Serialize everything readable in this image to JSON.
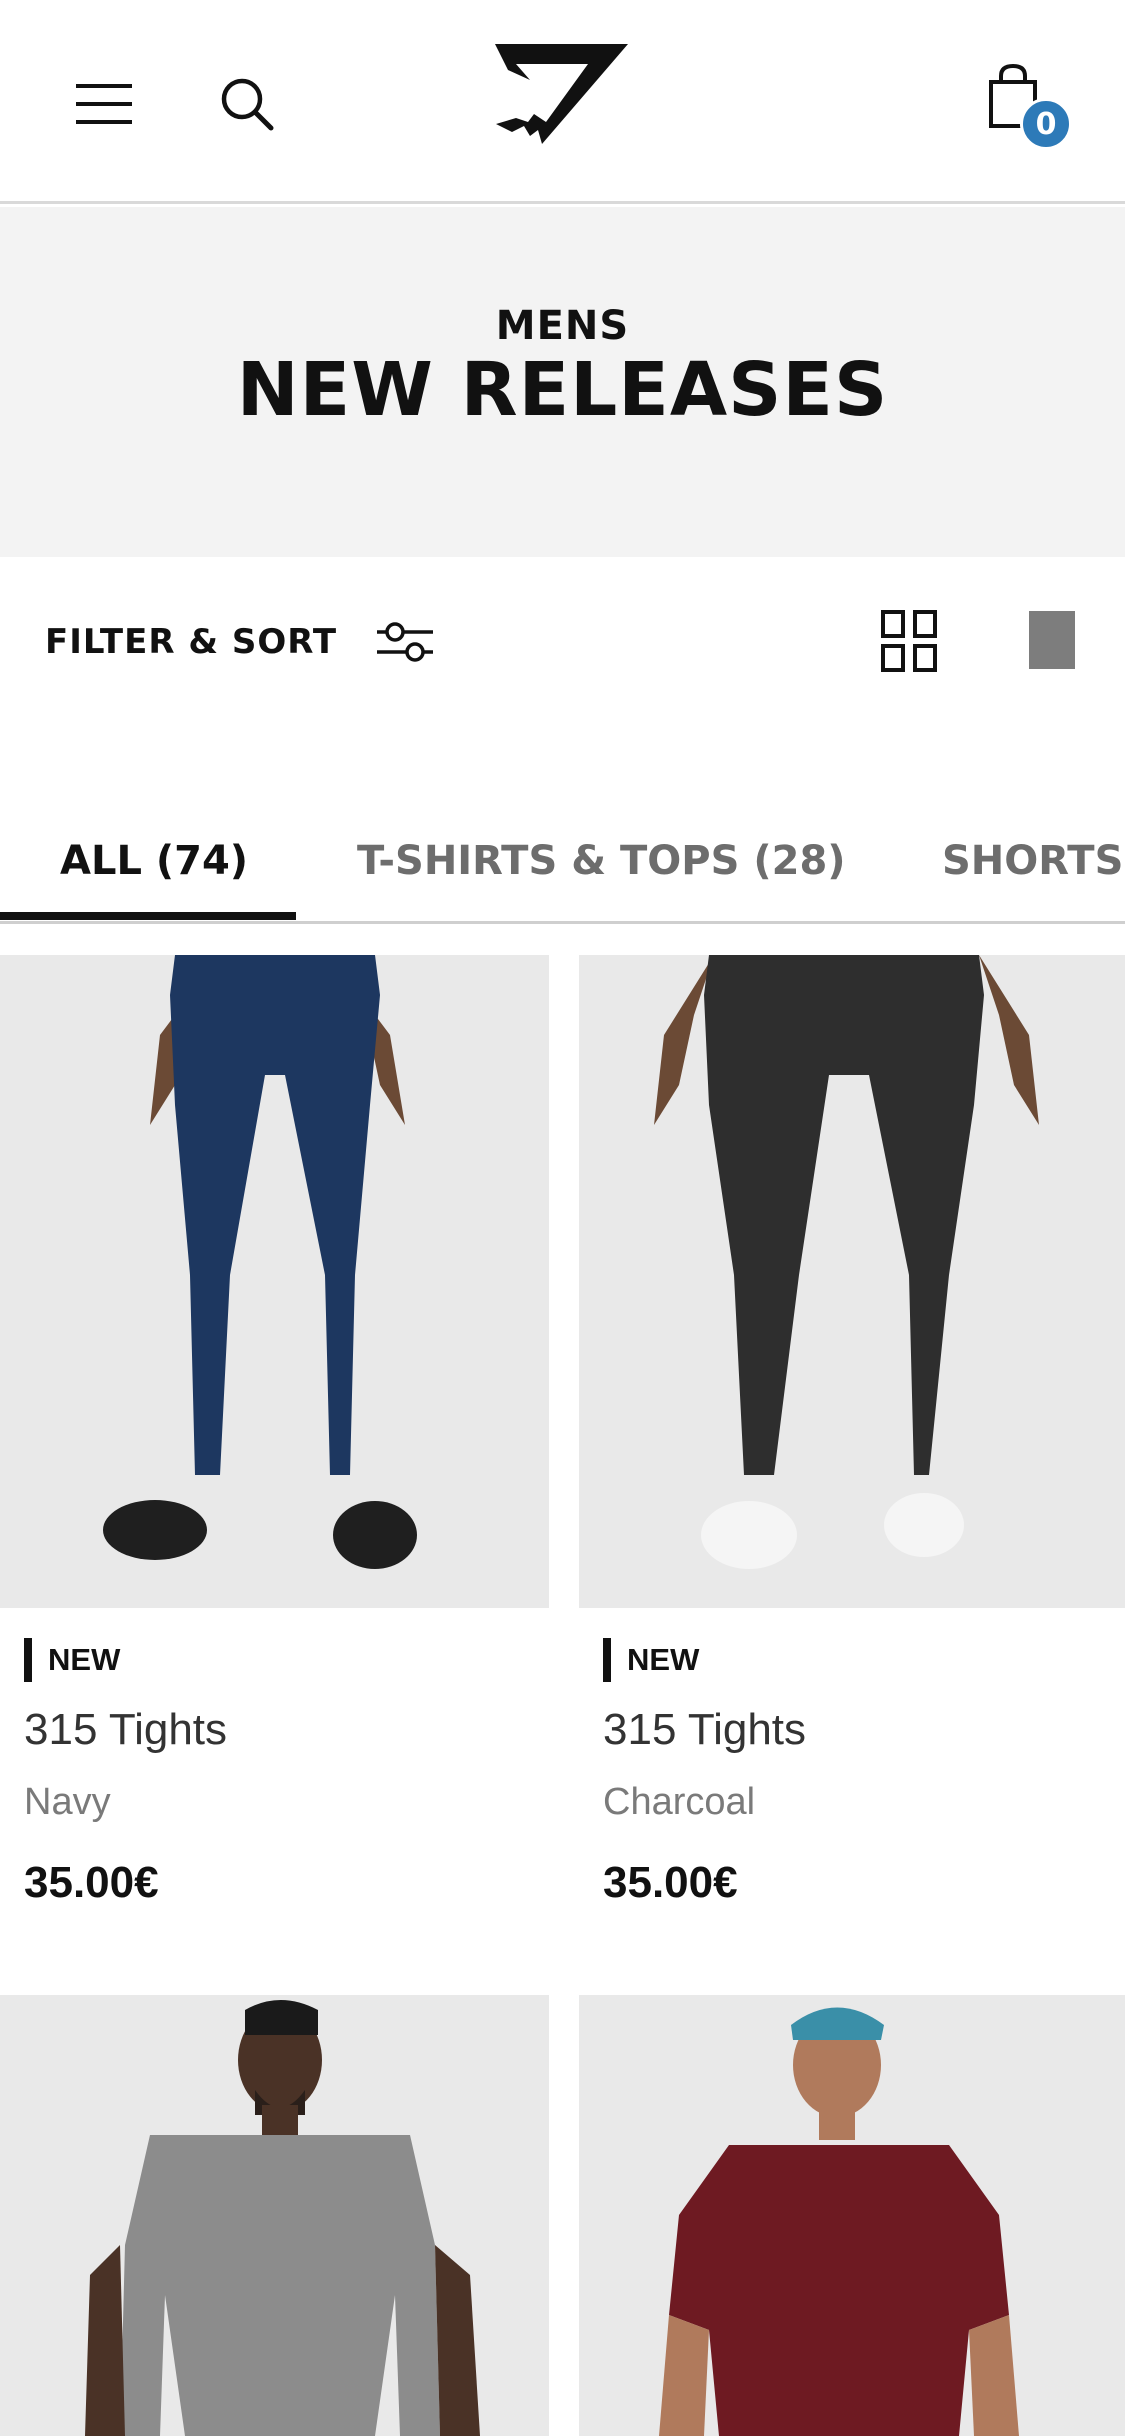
{
  "header": {
    "menu_icon": "hamburger-menu-icon",
    "search_icon": "search-icon",
    "logo_icon": "brand-logo",
    "bag_icon": "shopping-bag-icon",
    "bag_count": "0",
    "accent_color": "#2d7ab8"
  },
  "hero": {
    "subtitle": "MENS",
    "title": "NEW RELEASES"
  },
  "filter_bar": {
    "filter_label": "FILTER & SORT",
    "filter_icon": "sliders-icon",
    "grid_view_icon": "grid-view-icon",
    "single_view_icon": "single-view-icon"
  },
  "tabs": [
    {
      "label": "ALL (74)",
      "active": true
    },
    {
      "label": "T-SHIRTS & TOPS (28)",
      "active": false
    },
    {
      "label": "SHORTS",
      "active": false
    }
  ],
  "products": [
    {
      "badge": "NEW",
      "name": "315 Tights",
      "color": "Navy",
      "price": "35.00€",
      "garment_color": "#1d3760"
    },
    {
      "badge": "NEW",
      "name": "315 Tights",
      "color": "Charcoal",
      "price": "35.00€",
      "garment_color": "#2e2e2e"
    },
    {
      "garment_color": "#8c8c8c"
    },
    {
      "garment_color": "#6e1a22"
    }
  ]
}
